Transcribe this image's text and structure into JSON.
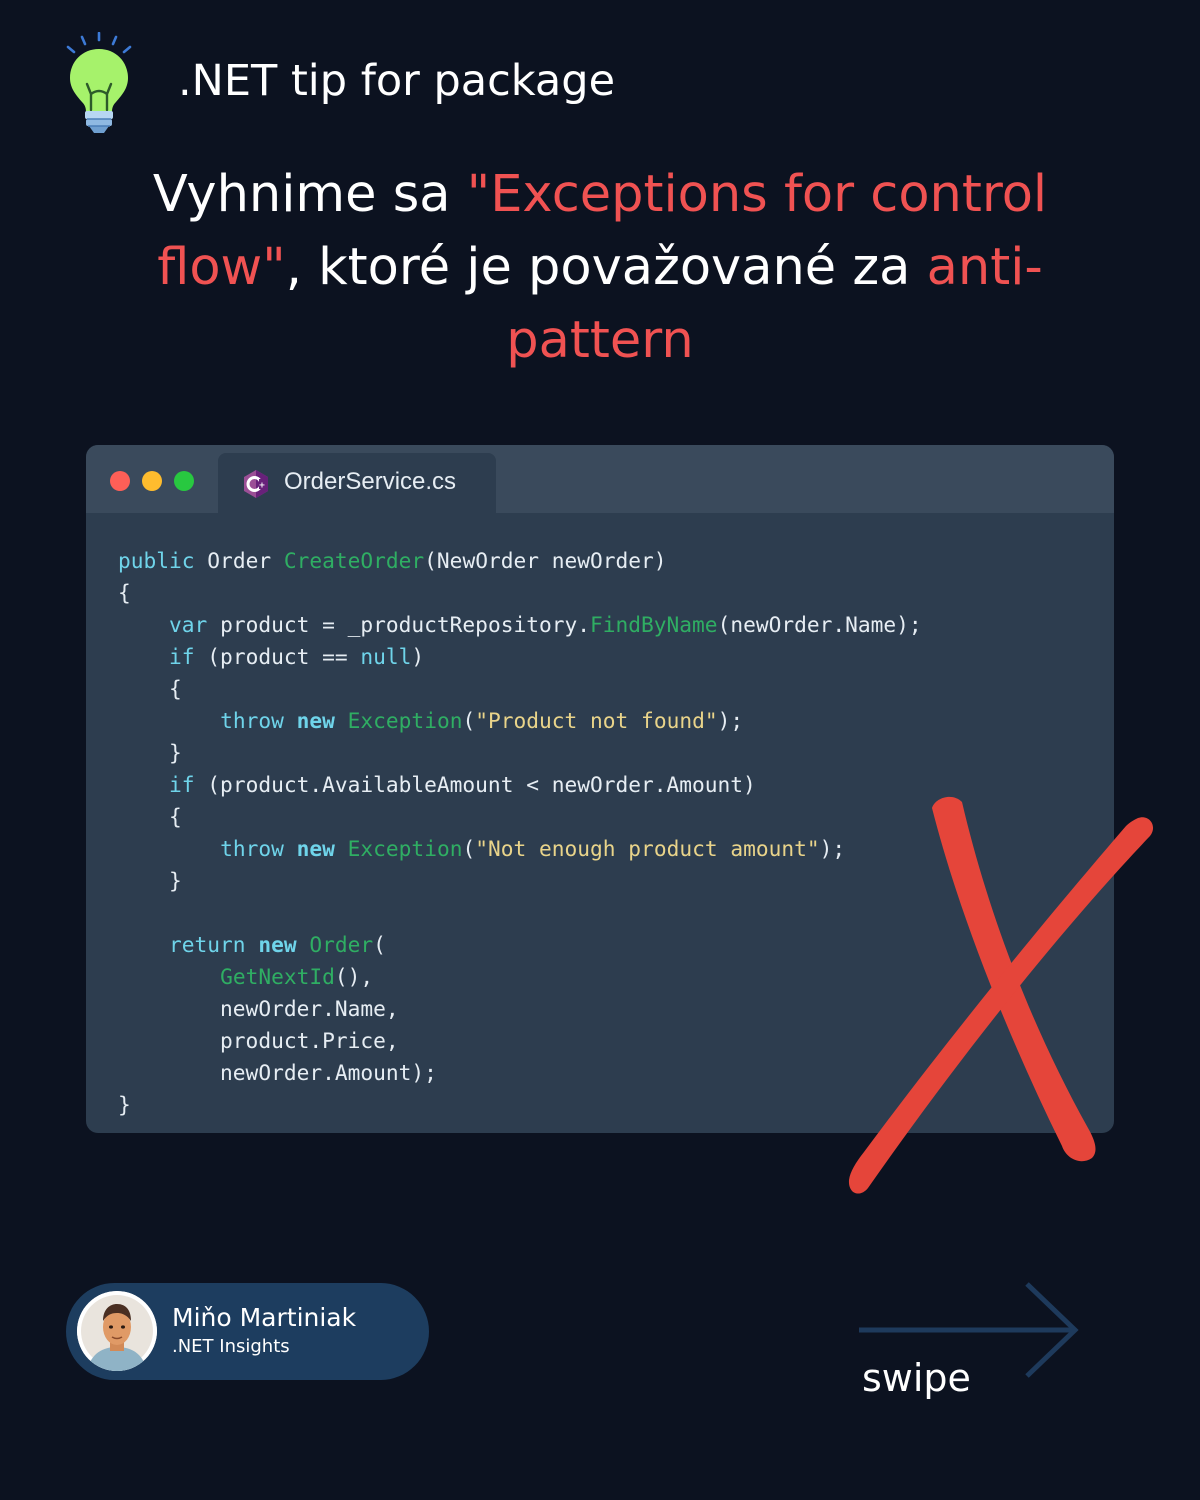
{
  "header": {
    "tip_title": ".NET tip for package",
    "icon": "lightbulb-icon"
  },
  "headline": {
    "part1": "Vyhnime sa ",
    "highlight1": "\"Exceptions for control flow\"",
    "part2": ", ktoré je považované za ",
    "highlight2": "anti-pattern"
  },
  "code_window": {
    "file_name": "OrderService.cs",
    "file_icon": "csharp-icon",
    "lines": [
      "public Order CreateOrder(NewOrder newOrder)",
      "{",
      "    var product = _productRepository.FindByName(newOrder.Name);",
      "    if (product == null)",
      "    {",
      "        throw new Exception(\"Product not found\");",
      "    }",
      "    if (product.AvailableAmount < newOrder.Amount)",
      "    {",
      "        throw new Exception(\"Not enough product amount\");",
      "    }",
      "",
      "    return new Order(",
      "        GetNextId(),",
      "        newOrder.Name,",
      "        product.Price,",
      "        newOrder.Amount);",
      "}"
    ],
    "overlay": "red-x-mark"
  },
  "author": {
    "name": "Miňo Martiniak",
    "subtitle": ".NET Insights"
  },
  "footer": {
    "swipe_label": "swipe",
    "arrow_icon": "arrow-right-icon"
  },
  "colors": {
    "background": "#0c1220",
    "highlight": "#f05252",
    "code_bg": "#2d3d4f",
    "titlebar_bg": "#3a4a5c",
    "keyword": "#6fd4ea",
    "function": "#2fae63",
    "string": "#e9d48a",
    "cross": "#e5453a",
    "author_card": "#1d3d5f",
    "arrow": "#1e3a5c"
  }
}
